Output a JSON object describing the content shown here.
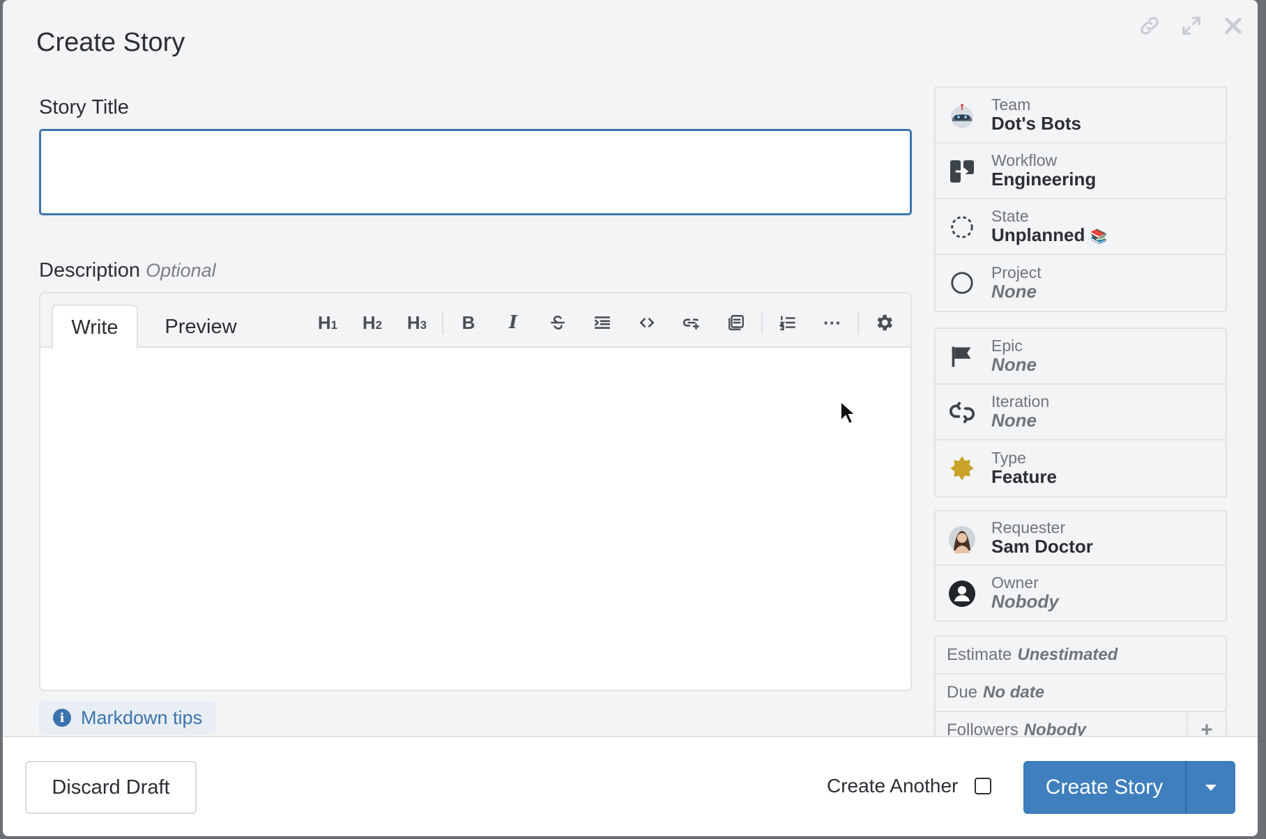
{
  "modal": {
    "title": "Create Story"
  },
  "form": {
    "story_title_label": "Story Title",
    "story_title_value": "",
    "description_label": "Description",
    "description_optional": "Optional",
    "markdown_tips": "Markdown tips"
  },
  "editor": {
    "tabs": [
      {
        "label": "Write",
        "active": true
      },
      {
        "label": "Preview",
        "active": false
      }
    ],
    "toolbar": {
      "h1": "H",
      "h1_sub": "1",
      "h2": "H",
      "h2_sub": "2",
      "h3": "H",
      "h3_sub": "3",
      "bold": "B",
      "italic": "I",
      "more": "···"
    }
  },
  "sidebar": {
    "group1": [
      {
        "label": "Team",
        "value": "Dot's Bots",
        "icon": "team-avatar-icon",
        "none": false
      },
      {
        "label": "Workflow",
        "value": "Engineering",
        "icon": "workflow-icon",
        "none": false
      },
      {
        "label": "State",
        "value": "Unplanned",
        "icon": "state-unstarted-icon",
        "none": false
      },
      {
        "label": "Project",
        "value": "None",
        "icon": "project-circle-icon",
        "none": true
      }
    ],
    "group2": [
      {
        "label": "Epic",
        "value": "None",
        "icon": "flag-icon",
        "none": true
      },
      {
        "label": "Iteration",
        "value": "None",
        "icon": "iteration-icon",
        "none": true
      },
      {
        "label": "Type",
        "value": "Feature",
        "icon": "feature-star-icon",
        "none": false
      }
    ],
    "group3": [
      {
        "label": "Requester",
        "value": "Sam Doctor",
        "icon": "requester-avatar",
        "none": false
      },
      {
        "label": "Owner",
        "value": "Nobody",
        "icon": "owner-avatar-icon",
        "none": true
      }
    ],
    "group4": [
      {
        "label": "Estimate",
        "value": "Unestimated"
      },
      {
        "label": "Due",
        "value": "No date"
      },
      {
        "label": "Followers",
        "value": "Nobody",
        "add": "+"
      }
    ]
  },
  "footer": {
    "discard_label": "Discard Draft",
    "create_another_label": "Create Another",
    "create_another_checked": false,
    "create_label": "Create Story"
  },
  "colors": {
    "accent": "#3f7fbd",
    "feature": "#c9a227",
    "input_border": "#3b74ad"
  }
}
